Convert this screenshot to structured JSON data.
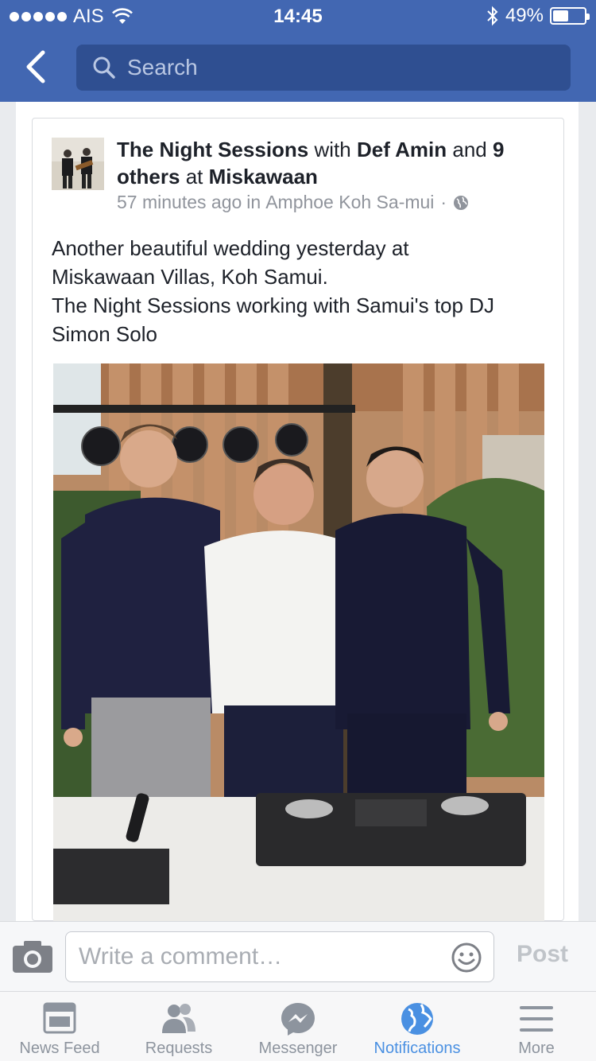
{
  "status_bar": {
    "carrier": "AIS",
    "time": "14:45",
    "battery": "49%",
    "battery_level": 0.49
  },
  "nav": {
    "search_placeholder": "Search"
  },
  "post": {
    "author": "The Night Sessions",
    "with_word": "with",
    "tagged": "Def Amin",
    "and_word": "and",
    "others": "9 others",
    "at_word": "at",
    "place": "Miskawaan",
    "time_ago": "57 minutes ago",
    "in_word": "in",
    "location": "Amphoe Koh Sa-mui",
    "separator": "·",
    "body_lines": [
      "Another beautiful wedding yesterday at",
      "Miskawaan Villas, Koh Samui.",
      "The Night Sessions working with Samui's top DJ",
      "Simon Solo"
    ]
  },
  "comment_bar": {
    "placeholder": "Write a comment…",
    "post_label": "Post"
  },
  "tabs": [
    {
      "label": "News Feed",
      "icon": "news-feed-icon"
    },
    {
      "label": "Requests",
      "icon": "requests-icon"
    },
    {
      "label": "Messenger",
      "icon": "messenger-icon"
    },
    {
      "label": "Notifications",
      "icon": "globe-icon",
      "active": true
    },
    {
      "label": "More",
      "icon": "menu-icon"
    }
  ],
  "colors": {
    "brand": "#4267b2",
    "active_tab": "#4a90e2"
  }
}
